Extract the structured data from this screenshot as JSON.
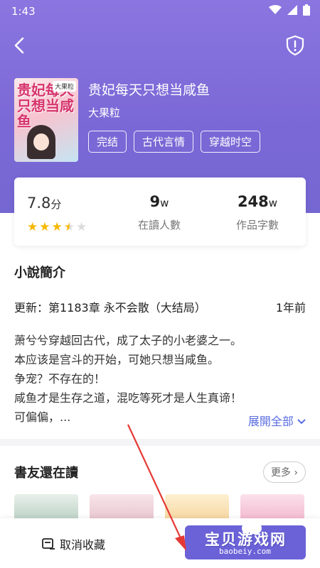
{
  "status_bar": {
    "time": "1:43"
  },
  "book": {
    "title": "贵妃每天只想当咸鱼",
    "author": "大果粒",
    "tags": [
      "完结",
      "古代言情",
      "穿越时空"
    ],
    "cover": {
      "title": "贵妃每天只想当咸鱼",
      "badge": "大果粒"
    }
  },
  "stats": {
    "score_value": "7.8",
    "score_unit": "分",
    "rating": 3.5,
    "readers_value": "9",
    "readers_unit": "w",
    "readers_label": "在讀人數",
    "words_value": "248",
    "words_unit": "w",
    "words_label": "作品字數"
  },
  "intro": {
    "section_title": "小說簡介",
    "update_label": "更新：第1183章 永不会散（大结局）",
    "update_time": "1年前",
    "lines": [
      "萧兮兮穿越回古代，成了太子的小老婆之一。",
      "本应该是宫斗的开始，可她只想当咸鱼。",
      "争宠？不存在的！",
      "咸鱼才是生存之道，混吃等死才是人生真谛！",
      "可偏偏，..."
    ],
    "expand_label": "展開全部"
  },
  "friends": {
    "section_title": "書友還在讀",
    "more_label": "更多"
  },
  "bottom": {
    "unfavorite_label": "取消收藏",
    "watermark_text": "宝贝游戏网",
    "watermark_url": "baobeiy.com"
  },
  "colors": {
    "hero": "#7a68d6",
    "accent": "#5b6de0",
    "star": "#f6b800",
    "read_button": "#6b62d8"
  }
}
